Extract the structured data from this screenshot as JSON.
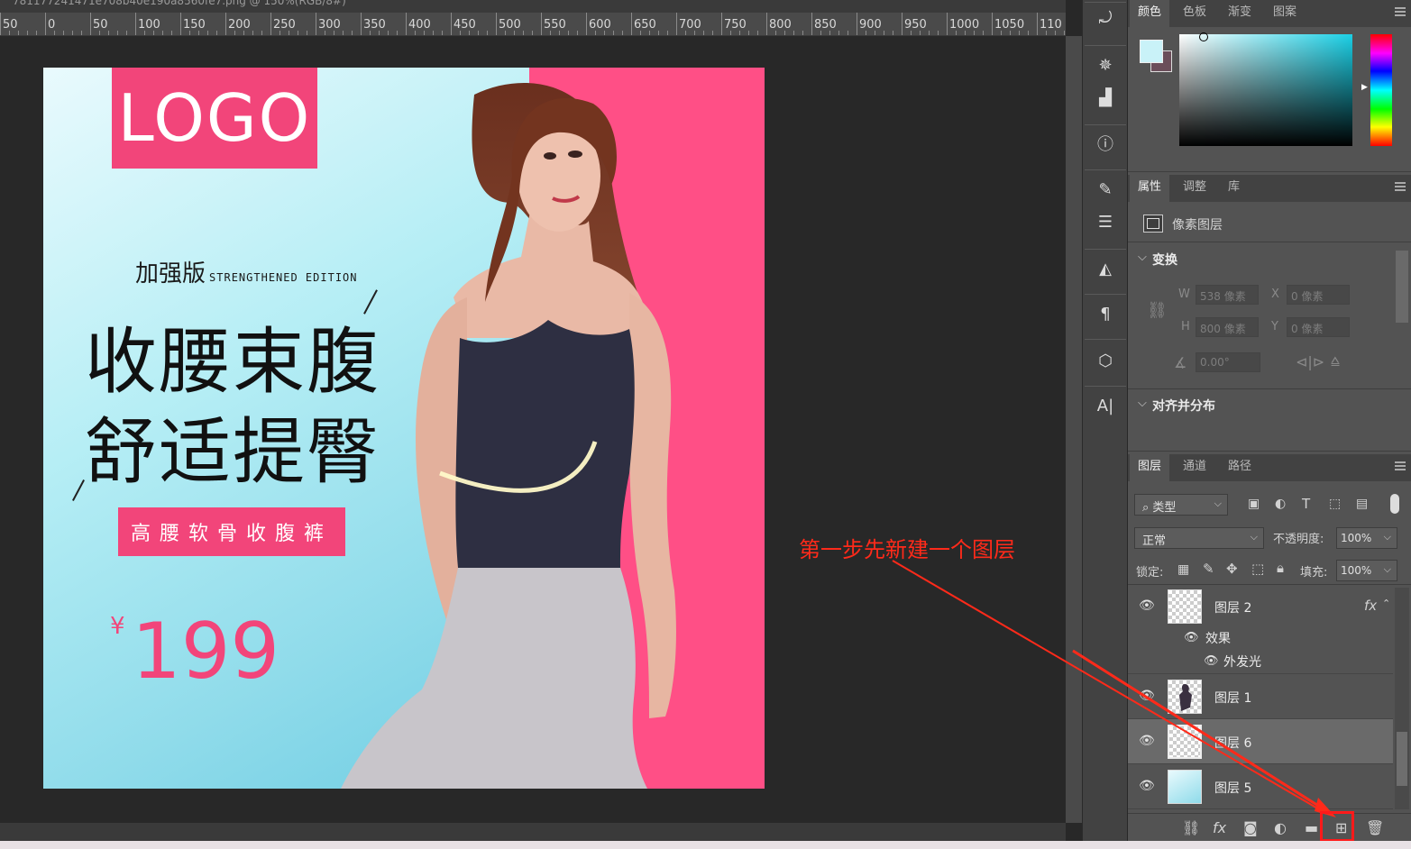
{
  "document": {
    "tab_title": "781177241471e708b40e190a8560fe7.png @ 150%(RGB/8#)"
  },
  "ruler": {
    "labels": [
      "50",
      "0",
      "50",
      "100",
      "150",
      "200",
      "250",
      "300",
      "350",
      "400",
      "450",
      "500",
      "550",
      "600",
      "650",
      "700",
      "750",
      "800",
      "850",
      "900",
      "950",
      "1000",
      "1050",
      "110"
    ]
  },
  "artwork": {
    "logo": "LOGO",
    "edition_cn": "加强版",
    "edition_en": "STRENGTHENED EDITION",
    "headline1": "收腰束腹",
    "headline2": "舒适提臀",
    "product": "高腰软骨收腹裤",
    "currency": "¥",
    "price": "199",
    "colors": {
      "pink": "#f2457a",
      "cyan_light": "#b6eef5"
    }
  },
  "color_panel": {
    "tabs": [
      "颜色",
      "色板",
      "渐变",
      "图案"
    ],
    "foreground": "#c9f2f8",
    "background": "#6b4e5a"
  },
  "properties_panel": {
    "tabs": [
      "属性",
      "调整",
      "库"
    ],
    "layer_type": "像素图层",
    "transform_title": "变换",
    "w_label": "W",
    "w_value": "538 像素",
    "x_label": "X",
    "x_value": "0 像素",
    "h_label": "H",
    "h_value": "800 像素",
    "y_label": "Y",
    "y_value": "0 像素",
    "angle_value": "0.00°",
    "align_title": "对齐并分布"
  },
  "layers_panel": {
    "tabs": [
      "图层",
      "通道",
      "路径"
    ],
    "filter_kind": "类型",
    "blend_mode": "正常",
    "opacity_label": "不透明度:",
    "opacity_value": "100%",
    "lock_label": "锁定:",
    "fill_label": "填充:",
    "fill_value": "100%",
    "layers": [
      {
        "name": "图层 2",
        "fx": "fx",
        "effects_label": "效果",
        "effect": "外发光"
      },
      {
        "name": "图层 1"
      },
      {
        "name": "图层 6"
      },
      {
        "name": "图层 5"
      }
    ]
  },
  "annotation": {
    "text": "第一步先新建一个图层"
  }
}
